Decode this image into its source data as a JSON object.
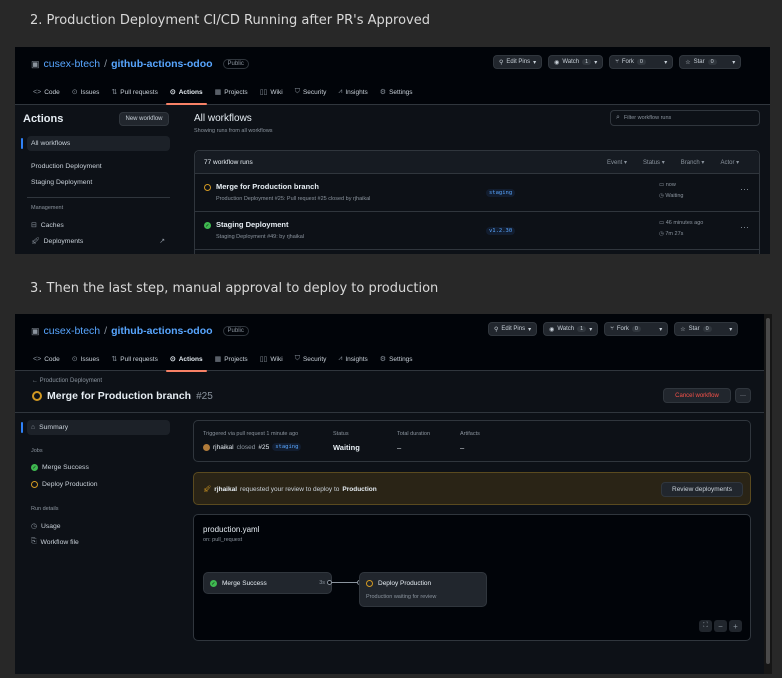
{
  "captions": {
    "step2": "2. Production Deployment CI/CD Running after PR's Approved",
    "step3": "3. Then the last step, manual approval to deploy to production"
  },
  "repo": {
    "owner": "cusex-btech",
    "slash": "/",
    "name": "github-actions-odoo",
    "visibility": "Public"
  },
  "header_buttons": {
    "edit_pins": "Edit Pins",
    "watch": "Watch",
    "watch_count": "1",
    "fork": "Fork",
    "fork_count": "0",
    "star": "Star",
    "star_count": "0"
  },
  "tabs": [
    "Code",
    "Issues",
    "Pull requests",
    "Actions",
    "Projects",
    "Wiki",
    "Security",
    "Insights",
    "Settings"
  ],
  "shot1": {
    "sidebar_title": "Actions",
    "new_workflow": "New workflow",
    "all_workflows": "All workflows",
    "workflows": [
      "Production Deployment",
      "Staging Deployment"
    ],
    "management": "Management",
    "caches": "Caches",
    "deployments": "Deployments",
    "main_title": "All workflows",
    "main_subtitle": "Showing runs from all workflows",
    "filter_placeholder": "Filter workflow runs",
    "runs_count": "77 workflow runs",
    "filters": [
      "Event",
      "Status",
      "Branch",
      "Actor"
    ],
    "runs": [
      {
        "title": "Merge for Production branch",
        "sub_workflow": "Production Deployment",
        "sub_detail": "#25: Pull request #25 closed by rjhaikal",
        "branch": "staging",
        "time": "now",
        "duration": "Waiting"
      },
      {
        "title": "Staging Deployment",
        "sub_workflow": "Staging Deployment",
        "sub_detail": "#49: by rjhaikal",
        "branch": "v1.2.30",
        "time": "46 minutes ago",
        "duration": "7m 27s"
      }
    ]
  },
  "shot2": {
    "breadcrumb": "Production Deployment",
    "title": "Merge for Production branch",
    "run_number": "#25",
    "cancel": "Cancel workflow",
    "summary": "Summary",
    "jobs_label": "Jobs",
    "jobs": [
      "Merge Success",
      "Deploy Production"
    ],
    "run_details": "Run details",
    "usage": "Usage",
    "workflow_file": "Workflow file",
    "info": {
      "triggered": "Triggered via pull request 1 minute ago",
      "user": "rjhaikal",
      "closed": "closed",
      "pr": "#25",
      "branch": "staging",
      "status_label": "Status",
      "status": "Waiting",
      "duration_label": "Total duration",
      "duration": "–",
      "artifacts_label": "Artifacts",
      "artifacts": "–"
    },
    "review": {
      "user": "rjhaikal",
      "text": "requested your review to deploy to",
      "env": "Production",
      "button": "Review deployments"
    },
    "graph": {
      "file": "production.yaml",
      "trigger": "on: pull_request",
      "job1": "Merge Success",
      "job1_time": "3s",
      "job2": "Deploy Production",
      "job2_sub": "Production waiting for review"
    }
  },
  "colors": {
    "accent": "#f78166",
    "link": "#58a6ff",
    "success": "#3fb950",
    "waiting": "#d29922",
    "danger": "#f85149"
  }
}
